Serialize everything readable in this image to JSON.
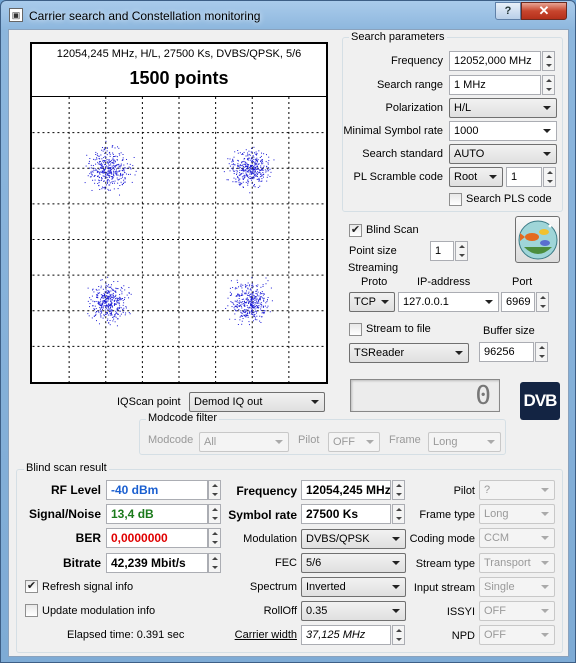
{
  "window": {
    "title": "Carrier search and Constellation monitoring",
    "help": "?",
    "close": "✕"
  },
  "scope": {
    "info": "12054,245 MHz, H/L, 27500 Ks, DVBS/QPSK, 5/6",
    "points": "1500 points"
  },
  "search": {
    "legend": "Search parameters",
    "frequency_label": "Frequency",
    "frequency_value": "12052,000 MHz",
    "range_label": "Search range",
    "range_value": "1 MHz",
    "polarization_label": "Polarization",
    "polarization_value": "H/L",
    "symrate_label": "Minimal Symbol rate",
    "symrate_value": "1000",
    "standard_label": "Search standard",
    "standard_value": "AUTO",
    "pls_label": "PL Scramble code",
    "pls_mode": "Root",
    "pls_value": "1",
    "search_pls_label": "Search PLS code"
  },
  "blind": {
    "label": "Blind Scan",
    "checked": "✔",
    "point_size_label": "Point size",
    "point_size_value": "1"
  },
  "streaming": {
    "legend": "Streaming",
    "proto_label": "Proto",
    "proto_value": "TCP",
    "ip_label": "IP-address",
    "ip_value": "127.0.0.1",
    "port_label": "Port",
    "port_value": "6969",
    "to_file_label": "Stream to file",
    "buffer_label": "Buffer size",
    "reader_value": "TSReader",
    "buffer_value": "96256"
  },
  "iqscan": {
    "label": "IQScan point",
    "value": "Demod IQ out"
  },
  "lcd": {
    "value": "0"
  },
  "dvb_logo": "DVB",
  "modcode": {
    "legend": "Modcode filter",
    "modcode_label": "Modcode",
    "modcode_value": "All",
    "pilot_label": "Pilot",
    "pilot_value": "OFF",
    "frame_label": "Frame",
    "frame_value": "Long"
  },
  "result": {
    "legend": "Blind scan result",
    "rf_label": "RF Level",
    "rf_value": "-40 dBm",
    "sn_label": "Signal/Noise",
    "sn_value": "13,4 dB",
    "ber_label": "BER",
    "ber_value": "0,0000000",
    "bitrate_label": "Bitrate",
    "bitrate_value": "42,239 Mbit/s",
    "refresh_label": "Refresh signal info",
    "refresh_checked": "✔",
    "update_label": "Update modulation info",
    "elapsed": "Elapsed time: 0.391 sec",
    "freq_label": "Frequency",
    "freq_value": "12054,245 MHz",
    "sr_label": "Symbol rate",
    "sr_value": "27500 Ks",
    "mod_label": "Modulation",
    "mod_value": "DVBS/QPSK",
    "fec_label": "FEC",
    "fec_value": "5/6",
    "spectrum_label": "Spectrum",
    "spectrum_value": "Inverted",
    "rolloff_label": "RollOff",
    "rolloff_value": "0.35",
    "cw_label": "Carrier width",
    "cw_value": "37,125 MHz",
    "pilot_label": "Pilot",
    "pilot_value": "?",
    "frametype_label": "Frame type",
    "frametype_value": "Long",
    "codingmode_label": "Coding mode",
    "codingmode_value": "CCM",
    "streamtype_label": "Stream type",
    "streamtype_value": "Transport",
    "inputstream_label": "Input stream",
    "inputstream_value": "Single",
    "issyi_label": "ISSYI",
    "issyi_value": "OFF",
    "npd_label": "NPD",
    "npd_value": "OFF"
  },
  "colors": {
    "rf": "#1a5fd0",
    "sn": "#1b7a1b",
    "ber": "#e00000",
    "points": "#1d1dd6"
  }
}
